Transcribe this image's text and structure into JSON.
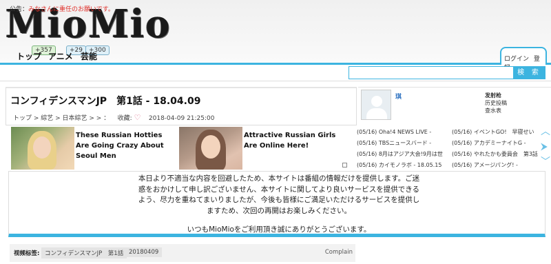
{
  "site": {
    "logo": "MioMio"
  },
  "nav": [
    {
      "label": "トップ",
      "badge": "+357"
    },
    {
      "label": "アニメ",
      "badge": "+29"
    },
    {
      "label": "芸能",
      "badge": "+300"
    }
  ],
  "account": {
    "login": "ログイン",
    "register": "登録"
  },
  "notice": {
    "prefix": "公告：",
    "text": "みなさんに重任のお願いです。"
  },
  "search": {
    "placeholder": "",
    "button": "検 索"
  },
  "video": {
    "title": "コンフィデンスマンJP　第1話 - 18.04.09",
    "breadcrumb": "トップ > 綜艺 > 日本綜艺 > >  ：",
    "favorite_label": "收藏:",
    "heart": "♡",
    "date": "2018-04-09 21:25:00"
  },
  "uploader": {
    "name": "琪"
  },
  "side_links": [
    "发射枪",
    "历史投稿",
    "查水表"
  ],
  "ads": [
    {
      "title": "These Russian Hotties Are Going Crazy About Seoul Men"
    },
    {
      "title": "Attractive Russian Girls Are Online Here!"
    }
  ],
  "news_left": [
    "(05/16) Oha!4 NEWS LIVE -",
    "(05/16) TBSニュースバード -",
    "(05/16) 8月はアジア大会!9月は世",
    "(05/16) カイモノラボ - 18.05.15"
  ],
  "news_right": [
    "(05/16) イベントGO!　早寝せい",
    "(05/16) アカデミーナイトG -",
    "(05/16) やれたかも委員会　第3話",
    "(05/16) アメージパング! -"
  ],
  "message": {
    "line1": "本日より不適当な内容を回避したため、本サイトは番組の情報だけを提供します。ご迷惑をおかけして申し訳ございません、本サイトに関してより良いサービスを提供できるよう、尽力を重ねてまいりましたが、今後も皆様にご満足いただけるサービスを提供しますため、次回の再開はお楽しみください。",
    "line2": "いつもMioMioをご利用頂き誠にありがとうございます。"
  },
  "tags": {
    "label": "视频标签:",
    "items": [
      "コンフィデンスマンJP　第1話",
      "20180409"
    ],
    "complain": "Complain"
  },
  "colors": {
    "accent": "#3cb4e0",
    "notice_highlight": "#e0302a",
    "link": "#2a6fbf"
  }
}
